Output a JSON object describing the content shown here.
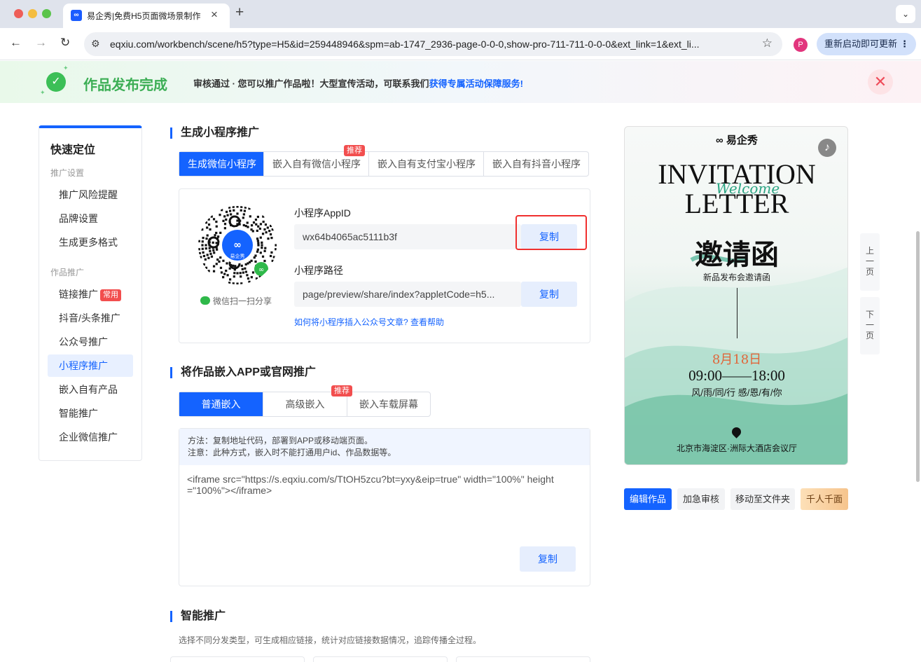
{
  "browser": {
    "tab_title": "易企秀|免费H5页面微场景制作",
    "tab_favicon": "∞",
    "url": "eqxiu.com/workbench/scene/h5?type=H5&id=259448946&spm=ab-1747_2936-page-0-0-0,show-pro-711-711-0-0-0&ext_link=1&ext_li...",
    "profile_initial": "P",
    "update_label": "重新启动即可更新"
  },
  "banner": {
    "title": "作品发布完成",
    "text": "审核通过 · 您可以推广作品啦！大型宣传活动，可联系我们",
    "link": "获得专属活动保障服务!"
  },
  "quicknav": {
    "title": "快速定位",
    "group1": "推广设置",
    "group1_items": [
      "推广风险提醒",
      "品牌设置",
      "生成更多格式"
    ],
    "group2": "作品推广",
    "group2_items": [
      "链接推广",
      "抖音/头条推广",
      "公众号推广",
      "小程序推广",
      "嵌入自有产品",
      "智能推广",
      "企业微信推广"
    ],
    "hot_tag": "常用",
    "active_index": 3
  },
  "miniprogram": {
    "section_title": "生成小程序推广",
    "tabs": [
      "生成微信小程序",
      "嵌入自有微信小程序",
      "嵌入自有支付宝小程序",
      "嵌入自有抖音小程序"
    ],
    "rec_tag": "推荐",
    "qr_brand": "易企秀",
    "qr_share": "微信扫一扫分享",
    "appid_label": "小程序AppID",
    "appid_value": "wx64b4065ac5111b3f",
    "path_label": "小程序路径",
    "path_value": "page/preview/share/index?appletCode=h5...",
    "copy_label": "复制",
    "help_link": "如何将小程序插入公众号文章? 查看帮助"
  },
  "embed": {
    "section_title": "将作品嵌入APP或官网推广",
    "tabs": [
      "普通嵌入",
      "高级嵌入",
      "嵌入车载屏幕"
    ],
    "rec_tag": "推荐",
    "method_line1": "方法：复制地址代码，部署到APP或移动端页面。",
    "method_line2": "注意：此种方式，嵌入时不能打通用户id、作品数据等。",
    "code": "<iframe src=\"https://s.eqxiu.com/s/TtOH5zcu?bt=yxy&eip=true\" width=\"100%\" height=\"100%\"></iframe>",
    "copy_label": "复制"
  },
  "smart": {
    "section_title": "智能推广",
    "desc": "选择不同分发类型，可生成相应链接，统计对应链接数据情况，追踪传播全过程。"
  },
  "preview": {
    "logo": "易企秀",
    "line1": "INVITATION",
    "line2": "LETTER",
    "welcome": "Welcome",
    "cn_title": "邀请函",
    "subtitle": "新品发布会邀请函",
    "date": "8月18日",
    "time": "09:00——18:00",
    "motto": "风/雨/同/行   感/恩/有/你",
    "address": "北京市海淀区·洲际大酒店会议厅",
    "prev_page": "上一页",
    "next_page": "下一页",
    "buttons": [
      "编辑作品",
      "加急审核",
      "移动至文件夹",
      "千人千面"
    ]
  },
  "colors": {
    "accent": "#1463ff",
    "success": "#3cbf57",
    "danger": "#f24e4e"
  }
}
